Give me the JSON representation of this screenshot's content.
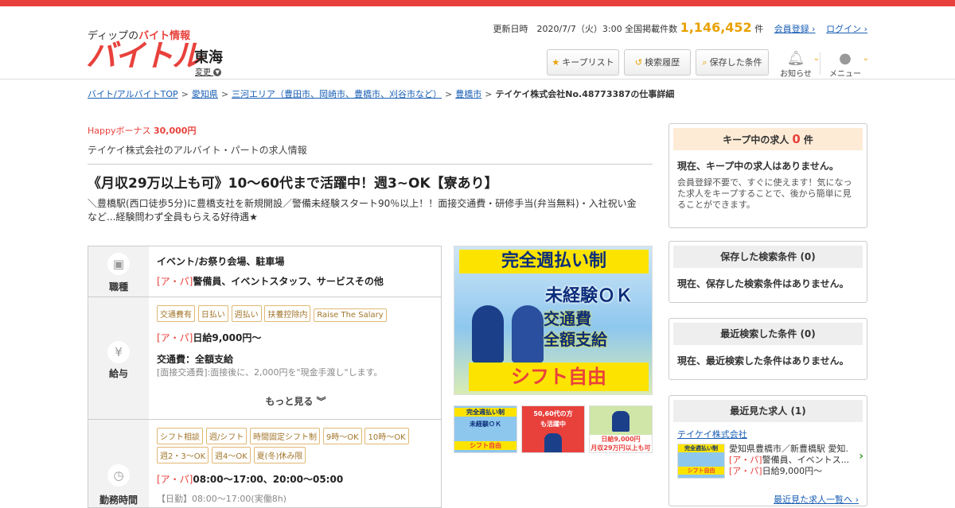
{
  "header": {
    "logo_sub_prefix": "ディップの",
    "logo_sub_highlight": "バイト情報",
    "logo_main": "バイトル",
    "region": "東海",
    "region_change": "変更",
    "update_label": "更新日時　2020/7/7（火）3:00 全国掲載件数",
    "total_count": "1,146,452",
    "count_unit": "件",
    "register_link": "会員登録",
    "login_link": "ログイン",
    "keep_list_btn": "キープリスト",
    "history_btn": "検索履歴",
    "saved_btn": "保存した条件",
    "notice_label": "お知らせ",
    "menu_label": "メニュー"
  },
  "breadcrumb": [
    "バイト/アルバイトTOP",
    "愛知県",
    "三河エリア（豊田市、岡崎市、豊橋市、刈谷市など）",
    "豊橋市",
    "テイケイ株式会社No.48773387の仕事詳細"
  ],
  "job": {
    "happy_label": "Happyボーナス",
    "happy_amount": "30,000円",
    "company_line": "テイケイ株式会社のアルバイト・パートの求人情報",
    "title": "《月収29万以上も可》10～60代まで活躍中！週3~OK【寮あり】",
    "description": "＼豊橋駅(西口徒歩5分)に豊橋支社を新規開設／警備未経験スタート90％以上！！面接交通費・研修手当(弁当無料)・入社祝い金など...経験問わず全員もらえる好待遇★"
  },
  "details": {
    "occupation_label": "職種",
    "occupation_place": "イベント/お祭り会場、駐車場",
    "occupation_type_tag": "[ア・パ]",
    "occupation_jobs": "警備員、イベントスタッフ、サービスその他",
    "salary_label": "給与",
    "salary_tags": [
      "交通費有",
      "日払い",
      "週払い",
      "扶養控除内",
      "Raise The Salary"
    ],
    "salary_type_tag": "[ア・パ]",
    "salary_amount": "日給9,000円～",
    "transport_title": "交通費：全額支給",
    "transport_note": "[面接交通費]:面接後に、2,000円を\"現金手渡し\"します。",
    "more_label": "もっと見る",
    "hours_label": "勤務時間",
    "hours_tags": [
      "シフト相談",
      "週/シフト",
      "時間固定シフト制",
      "9時～OK",
      "10時～OK",
      "週2・3〜OK",
      "週4〜OK",
      "夏(冬)休み限"
    ],
    "hours_type_tag": "[ア・パ]",
    "hours_value": "08:00～17:00、20:00～05:00",
    "hours_note": "【日勤】08:00～17:00(実働8h)"
  },
  "banner": {
    "line1": "完全週払い制",
    "line2": "未経験ＯＫ",
    "line3a": "交通費",
    "line3b": "全額支給",
    "line4": "シフト自由",
    "thumb2_a": "50,60代の方",
    "thumb2_b": "も活躍中",
    "thumb3_a": "日給9,000円",
    "thumb3_b": "月収29万円以上も可"
  },
  "sidebar": {
    "keep_title_prefix": "キープ中の求人",
    "keep_count": "0",
    "keep_unit": "件",
    "keep_empty": "現在、キープ中の求人はありません。",
    "keep_note": "会員登録不要で、すぐに使えます！気になった求人をキープすることで、後から簡単に見ることができます。",
    "saved_title": "保存した検索条件",
    "saved_count": "(0)",
    "saved_empty": "現在、保存した検索条件はありません。",
    "recent_search_title": "最近検索した条件",
    "recent_search_count": "(0)",
    "recent_search_empty": "現在、最近検索した条件はありません。",
    "recent_view_title": "最近見た求人",
    "recent_view_count": "(1)",
    "recent_company": "テイケイ株式会社",
    "recent_location": "愛知県豊橋市／新豊橋駅  愛知...",
    "recent_type_tag": "[ア・パ]",
    "recent_jobs": "警備員、イベントス...",
    "recent_salary": "日給9,000円～",
    "recent_list_link": "最近見た求人一覧へ"
  },
  "colors": {
    "brand": "#e8413c",
    "accent": "#e8a100",
    "link": "#1a5fb4"
  }
}
